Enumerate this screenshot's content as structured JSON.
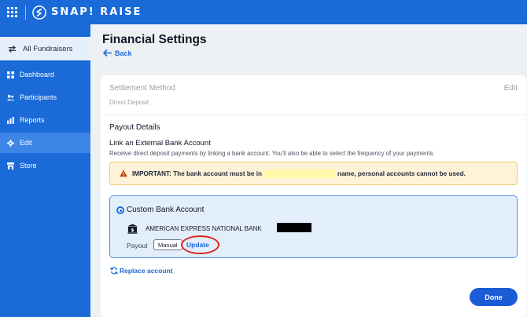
{
  "brand": {
    "name": "SNAP! RAISE",
    "color": "#1a6ad8",
    "icon": "snap-raise-logo-icon"
  },
  "apps_icon": "grid-apps-icon",
  "sidebar": {
    "all_fundraisers": {
      "label": "All Fundraisers",
      "icon": "swap-arrows-icon"
    },
    "items": [
      {
        "label": "Dashboard",
        "icon": "dashboard-icon",
        "active": false
      },
      {
        "label": "Participants",
        "icon": "participants-icon",
        "active": false
      },
      {
        "label": "Reports",
        "icon": "bar-chart-icon",
        "active": false
      },
      {
        "label": "Edit",
        "icon": "gear-icon",
        "active": true
      },
      {
        "label": "Store",
        "icon": "store-icon",
        "active": false
      }
    ]
  },
  "page": {
    "title": "Financial Settings",
    "back_label": "Back"
  },
  "settlement": {
    "label": "Settlement Method",
    "value": "Direct Deposit",
    "edit_label": "Edit"
  },
  "payout": {
    "title": "Payout Details",
    "link_title": "Link an External Bank Account",
    "link_desc": "Receive direct deposit payments by linking a bank account. You'll also be able to select the frequency of your payments."
  },
  "warning": {
    "text_before": "IMPORTANT: The bank account must be in",
    "text_after": "name, personal accounts cannot be used.",
    "color": "#fff2d8"
  },
  "bank": {
    "option_label": "Custom Bank Account",
    "bank_name": "AMERICAN EXPRESS NATIONAL BANK",
    "payout_label": "Payout",
    "mode_badge": "Manual",
    "update_label": "Update"
  },
  "replace_label": "Replace account",
  "done_label": "Done"
}
